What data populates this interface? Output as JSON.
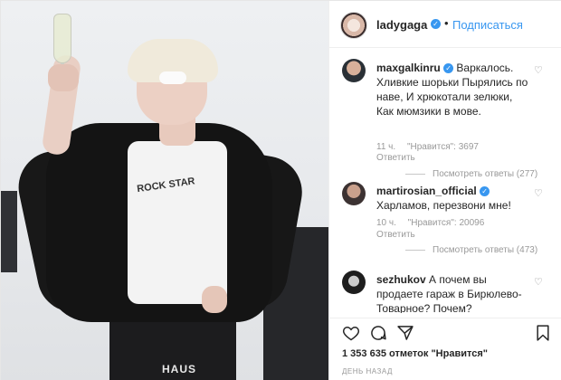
{
  "header": {
    "username": "ladygaga",
    "follow_label": "Подписаться",
    "dot": "•"
  },
  "photo": {
    "tee_text": "ROCK STAR",
    "belt_text": "HAUS"
  },
  "comments": [
    {
      "username": "maxgalkinru",
      "text": "Варкалось. Хливкие шорьки Пырялись по наве, И хрюкотали зелюки, Как мюмзики в мове.",
      "time": "11 ч.",
      "likes": "\"Нравится\": 3697",
      "reply": "Ответить",
      "view_replies": "Посмотреть ответы (277)"
    },
    {
      "username": "martirosian_official",
      "text": "Харламов, перезвони мне!",
      "time": "10 ч.",
      "likes": "\"Нравится\": 20096",
      "reply": "Ответить",
      "view_replies": "Посмотреть ответы (473)"
    },
    {
      "username": "sezhukov",
      "text": "А почем вы продаете гараж в Бирюлево-Товарное? Почем?"
    }
  ],
  "icons": {
    "like": "heart-icon",
    "comment": "comment-icon",
    "share": "share-icon",
    "save": "bookmark-icon",
    "verified": "verified-badge-icon",
    "comment_like": "small-heart-icon"
  },
  "likes_summary": "1 353 635 отметок \"Нравится\"",
  "date": "ДЕНЬ НАЗАД",
  "colors": {
    "accent": "#3897f0",
    "text": "#262626",
    "muted": "#999999",
    "border": "#efefef"
  }
}
